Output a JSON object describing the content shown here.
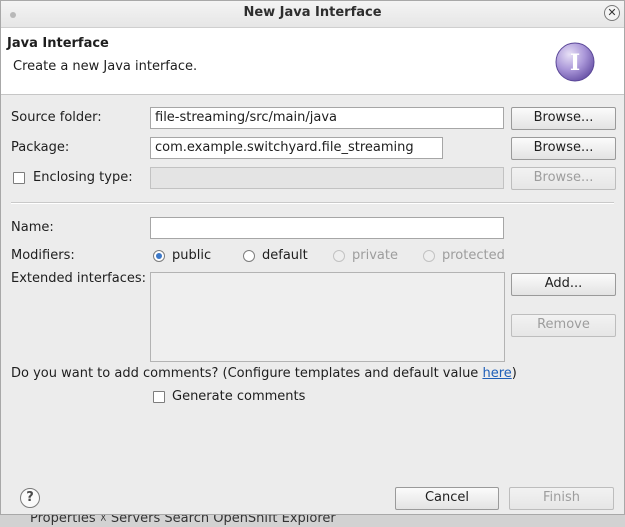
{
  "window": {
    "title": "New Java Interface",
    "close_icon": "close-icon"
  },
  "banner": {
    "title": "Java Interface",
    "description": "Create a new Java interface.",
    "icon": "interface-wizard-icon",
    "icon_letter": "I"
  },
  "form": {
    "source_folder": {
      "label": "Source folder:",
      "value": "file-streaming/src/main/java",
      "browse_label": "Browse..."
    },
    "package": {
      "label": "Package:",
      "value": "com.example.switchyard.file_streaming",
      "browse_label": "Browse..."
    },
    "enclosing_type": {
      "label": "Enclosing type:",
      "value": "",
      "checked": false,
      "browse_label": "Browse..."
    },
    "name": {
      "label": "Name:",
      "value": ""
    },
    "modifiers": {
      "label": "Modifiers:",
      "options": [
        "public",
        "default",
        "private",
        "protected"
      ],
      "selected": "public"
    },
    "extended_interfaces": {
      "label": "Extended interfaces:",
      "add_label": "Add...",
      "remove_label": "Remove"
    },
    "comments": {
      "question": "Do you want to add comments? (Configure templates and default value ",
      "link": "here",
      "question_end": ")",
      "generate_label": "Generate comments",
      "checked": false
    }
  },
  "footer": {
    "help_icon": "help-icon",
    "help_glyph": "?",
    "cancel_label": "Cancel",
    "finish_label": "Finish"
  },
  "background_strip": {
    "text": "Properties  ☓  Servers  Search  OpenShift Explorer"
  },
  "colors": {
    "dialog_bg": "#ececec",
    "banner_bg": "#ffffff",
    "link": "#1f5fb8",
    "radio_accent": "#3c78c8",
    "icon_purple": "#7a63b8"
  }
}
